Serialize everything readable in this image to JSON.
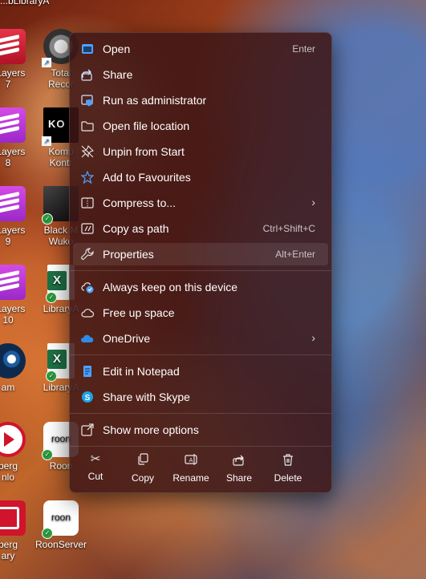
{
  "desktop": {
    "top_strip": "...bLibraryA",
    "col1": [
      {
        "label_a": "aLayers",
        "label_b": "7"
      },
      {
        "label_a": "aLayers",
        "label_b": "8"
      },
      {
        "label_a": "aLayers",
        "label_b": "9"
      },
      {
        "label_a": "aLayers",
        "label_b": "10"
      },
      {
        "label_a": "am",
        "label_b": ""
      },
      {
        "label_a": "berg",
        "label_b": "nlo"
      },
      {
        "label_a": "berg",
        "label_b": "ary"
      }
    ],
    "col2": [
      {
        "label_a": "Total",
        "label_b": "Recor"
      },
      {
        "label_a": "Komp",
        "label_b": "Kontr"
      },
      {
        "label_a": "Black M",
        "label_b": "Wuko"
      },
      {
        "label_a": "LibraryA",
        "label_b": ""
      },
      {
        "label_a": "LibraryA",
        "label_b": ""
      },
      {
        "label_a": "Roon",
        "label_b": ""
      },
      {
        "label_a": "RoonServer",
        "label_b": ""
      }
    ],
    "roon_text": "roon"
  },
  "menu": {
    "items": [
      {
        "label": "Open",
        "shortcut": "Enter",
        "icon": "open-icon"
      },
      {
        "label": "Share",
        "shortcut": "",
        "icon": "share-icon"
      },
      {
        "label": "Run as administrator",
        "shortcut": "",
        "icon": "shield-icon"
      },
      {
        "label": "Open file location",
        "shortcut": "",
        "icon": "folder-icon"
      },
      {
        "label": "Unpin from Start",
        "shortcut": "",
        "icon": "unpin-icon"
      },
      {
        "label": "Add to Favourites",
        "shortcut": "",
        "icon": "star-icon"
      },
      {
        "label": "Compress to...",
        "shortcut": "",
        "icon": "zip-icon"
      },
      {
        "label": "Copy as path",
        "shortcut": "Ctrl+Shift+C",
        "icon": "copy-path-icon"
      },
      {
        "label": "Properties",
        "shortcut": "Alt+Enter",
        "icon": "wrench-icon"
      },
      {
        "label": "Always keep on this device",
        "shortcut": "",
        "icon": "cloud-keep-icon"
      },
      {
        "label": "Free up space",
        "shortcut": "",
        "icon": "cloud-icon"
      },
      {
        "label": "OneDrive",
        "shortcut": "",
        "icon": "onedrive-icon"
      },
      {
        "label": "Edit in Notepad",
        "shortcut": "",
        "icon": "notepad-icon"
      },
      {
        "label": "Share with Skype",
        "shortcut": "",
        "icon": "skype-icon"
      },
      {
        "label": "Show more options",
        "shortcut": "",
        "icon": "more-options-icon"
      }
    ],
    "quick_actions": [
      {
        "label": "Cut",
        "icon": "scissors-icon"
      },
      {
        "label": "Copy",
        "icon": "copy-icon"
      },
      {
        "label": "Rename",
        "icon": "rename-icon"
      },
      {
        "label": "Share",
        "icon": "share-icon"
      },
      {
        "label": "Delete",
        "icon": "trash-icon"
      }
    ]
  },
  "colors": {
    "accent": "#4ea1ff",
    "menu_bg": "#3e1616",
    "check_green": "#2c9e3d"
  }
}
